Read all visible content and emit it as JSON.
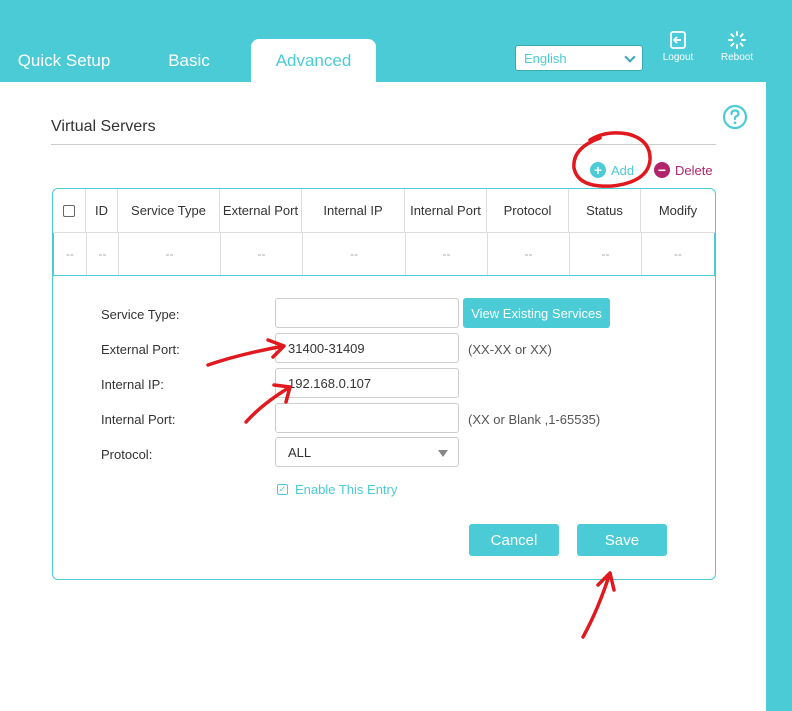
{
  "nav": {
    "tabs": [
      {
        "label": "Quick Setup"
      },
      {
        "label": "Basic"
      },
      {
        "label": "Advanced"
      }
    ],
    "language": "English",
    "logout_label": "Logout",
    "reboot_label": "Reboot"
  },
  "page": {
    "title": "Virtual Servers",
    "add_label": "Add",
    "delete_label": "Delete"
  },
  "table": {
    "headers": [
      "ID",
      "Service Type",
      "External Port",
      "Internal IP",
      "Internal Port",
      "Protocol",
      "Status",
      "Modify"
    ],
    "empty_row": [
      "--",
      "--",
      "--",
      "--",
      "--",
      "--",
      "--",
      "--",
      "--"
    ]
  },
  "form": {
    "service_type_label": "Service Type:",
    "service_type_value": "",
    "view_services_label": "View Existing Services",
    "external_port_label": "External Port:",
    "external_port_value": "31400-31409",
    "external_port_hint": "(XX-XX or XX)",
    "internal_ip_label": "Internal IP:",
    "internal_ip_value": "192.168.0.107",
    "internal_port_label": "Internal Port:",
    "internal_port_value": "",
    "internal_port_hint": "(XX or Blank ,1-65535)",
    "protocol_label": "Protocol:",
    "protocol_value": "ALL",
    "enable_label": "Enable This Entry",
    "enable_checked": true,
    "cancel_label": "Cancel",
    "save_label": "Save"
  },
  "colors": {
    "accent": "#4acbd6",
    "delete": "#b1246b",
    "annotation": "#e0191f"
  }
}
